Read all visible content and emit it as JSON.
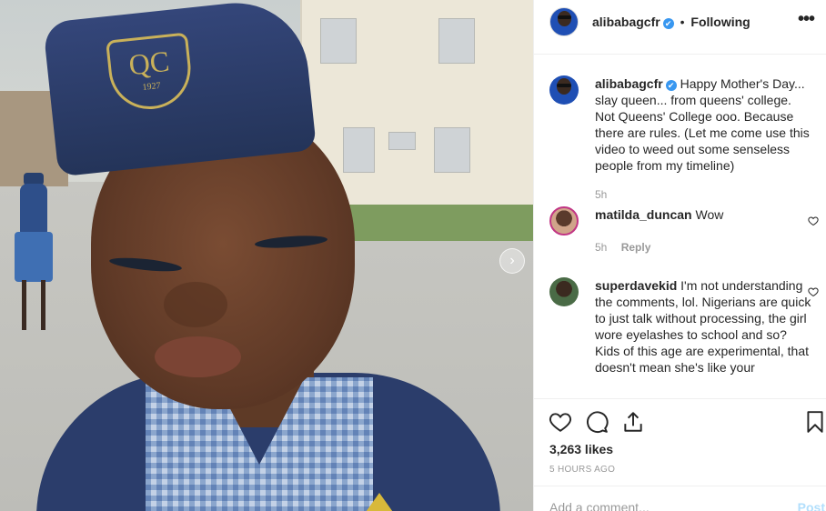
{
  "post": {
    "crest_letters": "QC",
    "crest_year": "1927"
  },
  "header": {
    "username": "alibabagcfr",
    "verified": "✔",
    "separator": "•",
    "following_label": "Following",
    "more": "•••"
  },
  "caption": {
    "username": "alibabagcfr",
    "verified": "✔",
    "text": "Happy Mother's Day... slay queen... from queens' college. Not Queens' College ooo. Because there are rules. (Let me come use this video to weed out some senseless people from my timeline)",
    "time": "5h"
  },
  "comments": [
    {
      "username": "matilda_duncan",
      "text": "Wow",
      "time": "5h",
      "reply_label": "Reply"
    },
    {
      "username": "superdavekid",
      "text": "I'm not understanding the comments, lol. Nigerians are quick to just talk without processing, the girl wore eyelashes to school and so? Kids of this age are experimental, that doesn't mean she's like your"
    }
  ],
  "actions": {
    "likes": "3,263 likes",
    "timestamp": "5 HOURS AGO"
  },
  "add_comment": {
    "placeholder": "Add a comment...",
    "post_label": "Post"
  },
  "icons": {
    "like": "heart-icon",
    "comment": "comment-icon",
    "share": "share-icon",
    "save": "bookmark-icon",
    "next": "chevron-right-icon"
  },
  "colors": {
    "accent": "#3897f0",
    "text": "#262626",
    "muted": "#999999",
    "post_disabled": "#b2dffc"
  }
}
